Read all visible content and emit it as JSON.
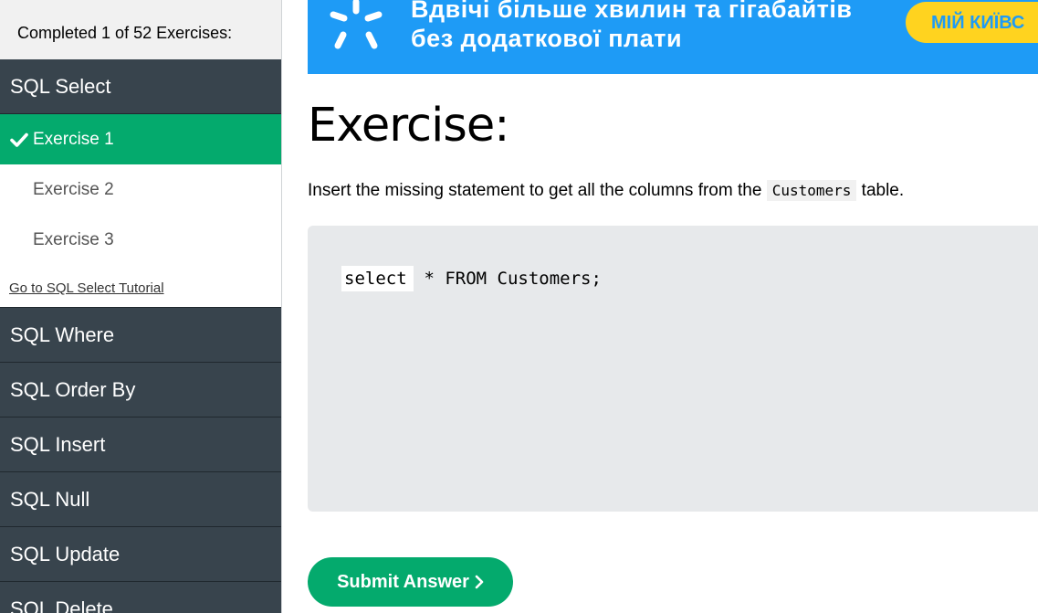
{
  "sidebar": {
    "progress_text": "Completed 1 of 52 Exercises:",
    "active_section": {
      "label": "SQL Select",
      "exercises": [
        {
          "label": "Exercise 1",
          "completed": true,
          "active": true
        },
        {
          "label": "Exercise 2",
          "completed": false,
          "active": false
        },
        {
          "label": "Exercise 3",
          "completed": false,
          "active": false
        }
      ],
      "tutorial_link": "Go to SQL Select Tutorial"
    },
    "sections": [
      "SQL Where",
      "SQL Order By",
      "SQL Insert",
      "SQL Null",
      "SQL Update",
      "SQL Delete"
    ]
  },
  "banner": {
    "line1": "Вдвічі більше хвилин та гігабайтів",
    "line2": "без додаткової плати",
    "button": "МІЙ КИЇВС",
    "colors": {
      "background": "#1e9bf6",
      "button": "#ffd31f"
    }
  },
  "main": {
    "title": "Exercise:",
    "instruction_before": "Insert the missing statement to get all the columns from the ",
    "instruction_code": "Customers",
    "instruction_after": " table.",
    "code": {
      "answer_value": "select",
      "rest": " * FROM Customers;"
    },
    "submit_label": "Submit Answer"
  },
  "colors": {
    "accent": "#04aa6d",
    "sidebar_dark": "#38444d",
    "code_bg": "#e7e9eb"
  },
  "icons": {
    "check": "check-icon",
    "chevron": "chevron-right-icon",
    "logo": "starburst-logo"
  }
}
